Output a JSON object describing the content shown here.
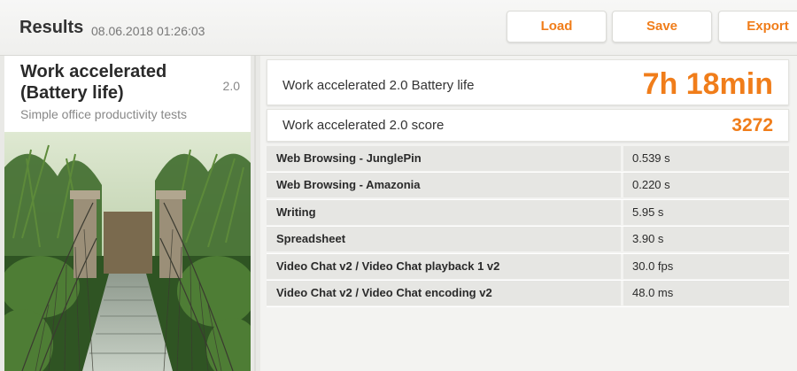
{
  "header": {
    "title": "Results",
    "timestamp": "08.06.2018 01:26:03",
    "buttons": {
      "load": "Load",
      "save": "Save",
      "export": "Export"
    }
  },
  "test": {
    "name": "Work accelerated (Battery life)",
    "version": "2.0",
    "description": "Simple office productivity tests"
  },
  "scores": {
    "battery_label": "Work accelerated 2.0 Battery life",
    "battery_value": "7h 18min",
    "score_label": "Work accelerated 2.0 score",
    "score_value": "3272"
  },
  "subtests": [
    {
      "name": "Web Browsing - JunglePin",
      "value": "0.539 s"
    },
    {
      "name": "Web Browsing - Amazonia",
      "value": "0.220 s"
    },
    {
      "name": "Writing",
      "value": "5.95 s"
    },
    {
      "name": "Spreadsheet",
      "value": "3.90 s"
    },
    {
      "name": "Video Chat v2 / Video Chat playback 1 v2",
      "value": "30.0 fps"
    },
    {
      "name": "Video Chat v2 / Video Chat encoding v2",
      "value": "48.0 ms"
    }
  ],
  "colors": {
    "accent": "#f07d1a",
    "background": "#e9e9e6",
    "row": "#e6e6e3"
  }
}
